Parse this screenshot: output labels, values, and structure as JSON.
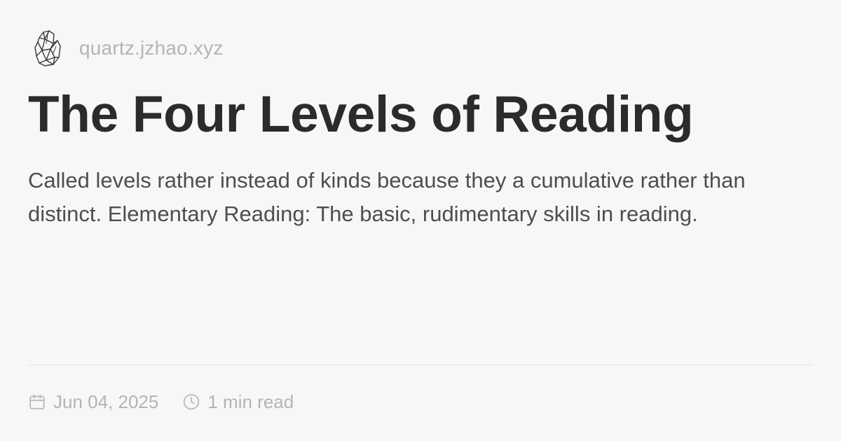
{
  "site": {
    "logo_icon": "crystal-logo-icon",
    "url": "quartz.jzhao.xyz"
  },
  "article": {
    "title": "The Four Levels of Reading",
    "description": "Called levels rather instead of kinds because they a cumulative rather than distinct. Elementary Reading: The basic, rudimentary skills in reading."
  },
  "meta": {
    "date_icon": "calendar-icon",
    "date": "Jun 04, 2025",
    "read_icon": "clock-icon",
    "reading_time": "1 min read"
  },
  "colors": {
    "background": "#f8f7f8",
    "title": "#2b2b2b",
    "body_text": "#4e4e4e",
    "muted_text": "#b4b4b6",
    "divider": "#e4e3e5"
  }
}
